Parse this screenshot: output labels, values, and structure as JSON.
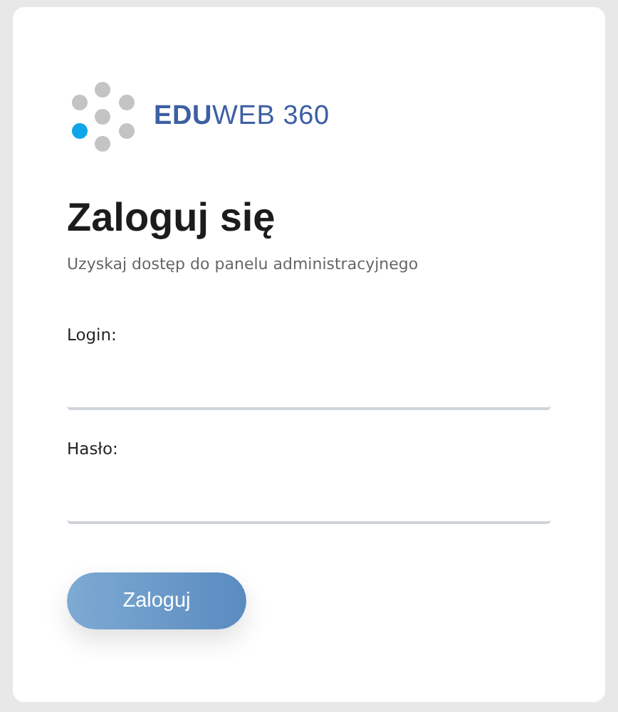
{
  "logo": {
    "text": "**EDU**WEB 360"
  },
  "title": "Zaloguj się",
  "subtitle": "Uzyskaj dostęp do panelu administracyjnego",
  "fields": [
    {
      "label": "Login:"
    },
    {
      "label": "Hasło:"
    }
  ],
  "button": {
    "label": "Zaloguj"
  }
}
